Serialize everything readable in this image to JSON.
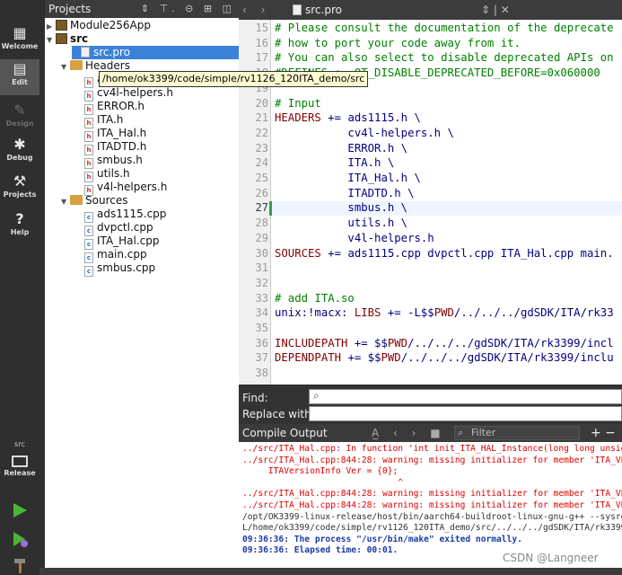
{
  "modes": [
    {
      "label": "Welcome",
      "icon": "grid-icon",
      "state": "normal"
    },
    {
      "label": "Edit",
      "icon": "document-icon",
      "state": "active"
    },
    {
      "label": "Design",
      "icon": "pencil-icon",
      "state": "disabled"
    },
    {
      "label": "Debug",
      "icon": "bug-icon",
      "state": "normal"
    },
    {
      "label": "Projects",
      "icon": "wrench-icon",
      "state": "normal"
    },
    {
      "label": "Help",
      "icon": "question-icon",
      "state": "normal"
    }
  ],
  "kit": {
    "label": "src",
    "build": "Release"
  },
  "projects": {
    "header": "Projects",
    "tree": [
      {
        "label": "Module256App",
        "kind": "project",
        "depth": 0,
        "arrow": "▶"
      },
      {
        "label": "src",
        "kind": "project",
        "depth": 0,
        "arrow": "▼",
        "bold": true
      },
      {
        "label": "src.pro",
        "kind": "file",
        "depth": 1,
        "selected": true
      },
      {
        "label": "Headers",
        "kind": "folder",
        "depth": 1,
        "arrow": "▼"
      },
      {
        "label": "ads1115.h",
        "kind": "h",
        "depth": 2
      },
      {
        "label": "cv4l-helpers.h",
        "kind": "h",
        "depth": 2
      },
      {
        "label": "ERROR.h",
        "kind": "h",
        "depth": 2
      },
      {
        "label": "ITA.h",
        "kind": "h",
        "depth": 2
      },
      {
        "label": "ITA_Hal.h",
        "kind": "h",
        "depth": 2
      },
      {
        "label": "ITADTD.h",
        "kind": "h",
        "depth": 2
      },
      {
        "label": "smbus.h",
        "kind": "h",
        "depth": 2
      },
      {
        "label": "utils.h",
        "kind": "h",
        "depth": 2
      },
      {
        "label": "v4l-helpers.h",
        "kind": "h",
        "depth": 2
      },
      {
        "label": "Sources",
        "kind": "folder",
        "depth": 1,
        "arrow": "▼"
      },
      {
        "label": "ads1115.cpp",
        "kind": "cpp",
        "depth": 2
      },
      {
        "label": "dvpctl.cpp",
        "kind": "cpp",
        "depth": 2
      },
      {
        "label": "ITA_Hal.cpp",
        "kind": "cpp",
        "depth": 2
      },
      {
        "label": "main.cpp",
        "kind": "cpp",
        "depth": 2
      },
      {
        "label": "smbus.cpp",
        "kind": "cpp",
        "depth": 2
      }
    ],
    "tooltip": "/home/ok3399/code/simple/rv1126_120ITA_demo/src"
  },
  "editor": {
    "file_tab": "src.pro",
    "lines": [
      {
        "n": "15",
        "parts": [
          {
            "t": "# Please consult the documentation of the deprecate",
            "c": "cmt"
          }
        ]
      },
      {
        "n": "16",
        "parts": [
          {
            "t": "# how to port your code away from it.",
            "c": "cmt"
          }
        ]
      },
      {
        "n": "17",
        "parts": [
          {
            "t": "# You can also select to disable deprecated APIs on",
            "c": "cmt"
          }
        ]
      },
      {
        "n": "18",
        "parts": [
          {
            "t": "#DEFINES += QT_DISABLE_DEPRECATED_BEFORE=0x060000",
            "c": "cmt"
          }
        ]
      },
      {
        "n": "19",
        "parts": []
      },
      {
        "n": "20",
        "parts": [
          {
            "t": "# Input",
            "c": "cmt"
          }
        ]
      },
      {
        "n": "21",
        "parts": [
          {
            "t": "HEADERS",
            "c": "var"
          },
          {
            "t": " += ads1115.h \\",
            "c": "txt"
          }
        ]
      },
      {
        "n": "22",
        "parts": [
          {
            "t": "           cv4l-helpers.h \\",
            "c": "txt"
          }
        ]
      },
      {
        "n": "23",
        "parts": [
          {
            "t": "           ERROR.h \\",
            "c": "txt"
          }
        ]
      },
      {
        "n": "24",
        "parts": [
          {
            "t": "           ITA.h \\",
            "c": "txt"
          }
        ]
      },
      {
        "n": "25",
        "parts": [
          {
            "t": "           ITA_Hal.h \\",
            "c": "txt"
          }
        ]
      },
      {
        "n": "26",
        "parts": [
          {
            "t": "           ITADTD.h \\",
            "c": "txt"
          }
        ]
      },
      {
        "n": "27",
        "parts": [
          {
            "t": "           smbus.h \\",
            "c": "txt"
          }
        ]
      },
      {
        "n": "28",
        "parts": [
          {
            "t": "           utils.h \\",
            "c": "txt"
          }
        ]
      },
      {
        "n": "29",
        "parts": [
          {
            "t": "           v4l-helpers.h",
            "c": "txt"
          }
        ]
      },
      {
        "n": "30",
        "parts": [
          {
            "t": "SOURCES",
            "c": "var"
          },
          {
            "t": " += ads1115.cpp dvpctl.cpp ITA_Hal.cpp main.",
            "c": "txt"
          }
        ]
      },
      {
        "n": "31",
        "parts": []
      },
      {
        "n": "32",
        "parts": []
      },
      {
        "n": "33",
        "parts": [
          {
            "t": "# add ITA.so",
            "c": "cmt"
          }
        ]
      },
      {
        "n": "34",
        "parts": [
          {
            "t": "unix:!macx: ",
            "c": "txt"
          },
          {
            "t": "LIBS",
            "c": "var"
          },
          {
            "t": " += -L$$",
            "c": "txt"
          },
          {
            "t": "PWD",
            "c": "var"
          },
          {
            "t": "/../../../gdSDK/ITA/rk33",
            "c": "txt"
          }
        ]
      },
      {
        "n": "35",
        "parts": []
      },
      {
        "n": "36",
        "parts": [
          {
            "t": "INCLUDEPATH",
            "c": "var"
          },
          {
            "t": " += $$",
            "c": "txt"
          },
          {
            "t": "PWD",
            "c": "var"
          },
          {
            "t": "/../../../gdSDK/ITA/rk3399/incl",
            "c": "txt"
          }
        ]
      },
      {
        "n": "37",
        "parts": [
          {
            "t": "DEPENDPATH",
            "c": "var"
          },
          {
            "t": " += $$",
            "c": "txt"
          },
          {
            "t": "PWD",
            "c": "var"
          },
          {
            "t": "/../../../gdSDK/ITA/rk3399/inclu",
            "c": "txt"
          }
        ]
      },
      {
        "n": "38",
        "parts": []
      }
    ],
    "current_line": "27"
  },
  "find": {
    "find_label": "Find:",
    "replace_label": "Replace with:",
    "find_value": "",
    "replace_value": ""
  },
  "output": {
    "title": "Compile Output",
    "filter_placeholder": "Filter",
    "lines": [
      {
        "t": "../src/ITA_Hal.cpp: In function 'int init_ITA_HAL_Instance(long long unsig",
        "s": "red"
      },
      {
        "t": "../src/ITA_Hal.cpp:844:28: warning: missing initializer for member 'ITA_VE",
        "s": "red"
      },
      {
        "t": "     ITAVersionInfo Ver = {0};",
        "s": "red"
      },
      {
        "t": "                              ^",
        "s": "red"
      },
      {
        "t": "../src/ITA_Hal.cpp:844:28: warning: missing initializer for member 'ITA_VE",
        "s": "red"
      },
      {
        "t": "../src/ITA_Hal.cpp:844:28: warning: missing initializer for member 'ITA_VE",
        "s": "red"
      },
      {
        "t": "/opt/OK3399-linux-release/host/bin/aarch64-buildroot-linux-gnu-g++ --sysro",
        "s": "plain"
      },
      {
        "t": "L/home/ok3399/code/simple/rv1126_120ITA_demo/src/../../../gdSDK/ITA/rk3399/",
        "s": "plain"
      },
      {
        "t": "09:36:36: The process \"/usr/bin/make\" exited normally.",
        "s": "blue"
      },
      {
        "t": "09:36:36: Elapsed time: 00:01.",
        "s": "blue"
      }
    ]
  },
  "watermark": "CSDN @Langneer"
}
